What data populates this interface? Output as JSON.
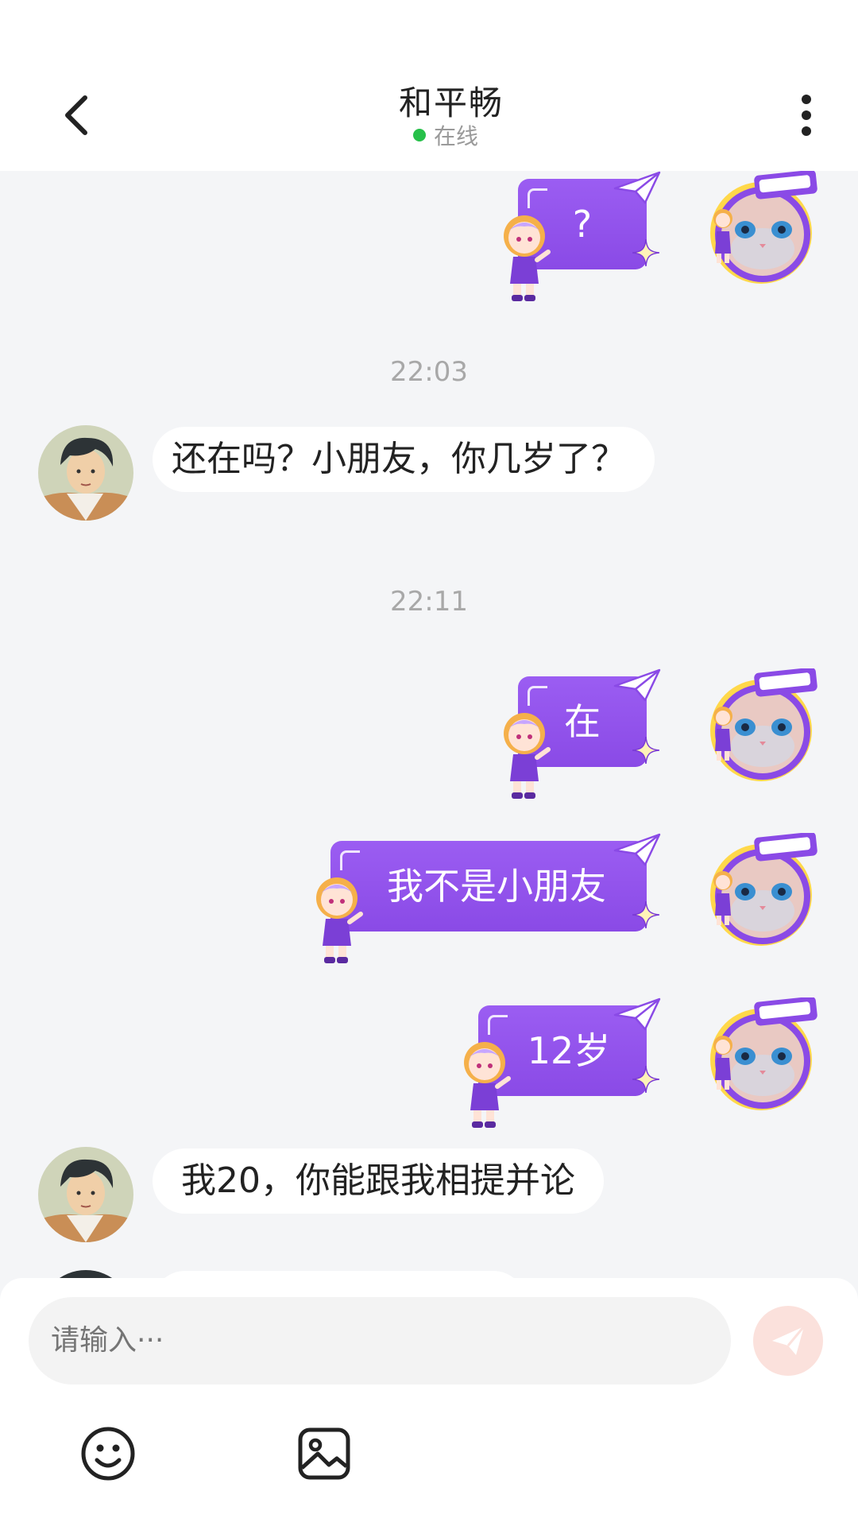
{
  "header": {
    "title": "和平畅",
    "status": "在线",
    "back_icon": "chevron-left-icon",
    "more_icon": "more-vertical-icon"
  },
  "messages": [
    {
      "side": "right",
      "text": "?"
    },
    {
      "type": "time",
      "text": "22:03"
    },
    {
      "side": "left",
      "text": "还在吗？小朋友，你几岁了？"
    },
    {
      "type": "time",
      "text": "22:11"
    },
    {
      "side": "right",
      "text": "在"
    },
    {
      "side": "right",
      "text": "我不是小朋友"
    },
    {
      "side": "right",
      "text": "12岁"
    },
    {
      "side": "left",
      "text": "我20，你能跟我相提并论"
    }
  ],
  "input": {
    "placeholder": "请输入···"
  },
  "toolbar": {
    "emoji_icon": "smiley-icon",
    "image_icon": "image-icon",
    "send_icon": "send-plane-icon"
  },
  "colors": {
    "bubble_right": "#8f52ea",
    "bubble_left": "#ffffff",
    "online_dot": "#27c04a",
    "send_button": "#fbe1dc",
    "background": "#f4f5f7"
  }
}
